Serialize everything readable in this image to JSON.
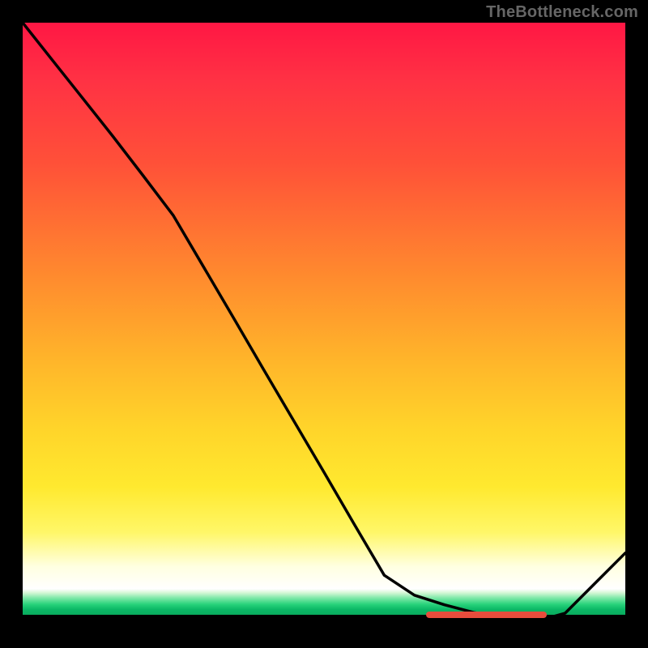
{
  "watermark": "TheBottleneck.com",
  "chart_data": {
    "type": "line",
    "title": "",
    "xlabel": "",
    "ylabel": "",
    "xlim": [
      0,
      100
    ],
    "ylim": [
      0,
      100
    ],
    "grid": false,
    "legend": false,
    "series": [
      {
        "name": "main-curve",
        "x": [
          0,
          5,
          10,
          15,
          20,
          25,
          30,
          35,
          40,
          45,
          50,
          55,
          60,
          65,
          70,
          75,
          80,
          85,
          90,
          95,
          100
        ],
        "y": [
          100,
          93.7,
          87.4,
          81.1,
          74.6,
          68.0,
          59.5,
          51.0,
          42.4,
          33.9,
          25.4,
          16.8,
          8.3,
          5.0,
          3.4,
          2.1,
          1.2,
          0.6,
          2.0,
          7.0,
          12.0
        ]
      }
    ],
    "gradient_stops": [
      {
        "pct": 0,
        "color": "#ff1744"
      },
      {
        "pct": 25,
        "color": "#ff5138"
      },
      {
        "pct": 50,
        "color": "#ffb62a"
      },
      {
        "pct": 75,
        "color": "#ffe92f"
      },
      {
        "pct": 94,
        "color": "#ffffff"
      },
      {
        "pct": 96,
        "color": "#7fe8a8"
      },
      {
        "pct": 98,
        "color": "#0bb765"
      },
      {
        "pct": 100,
        "color": "#000000"
      }
    ],
    "floor_marker": {
      "x_start": 67,
      "x_end": 87,
      "color": "#e74c3c"
    }
  },
  "plot": {
    "inner_w": 744,
    "inner_h": 744
  }
}
